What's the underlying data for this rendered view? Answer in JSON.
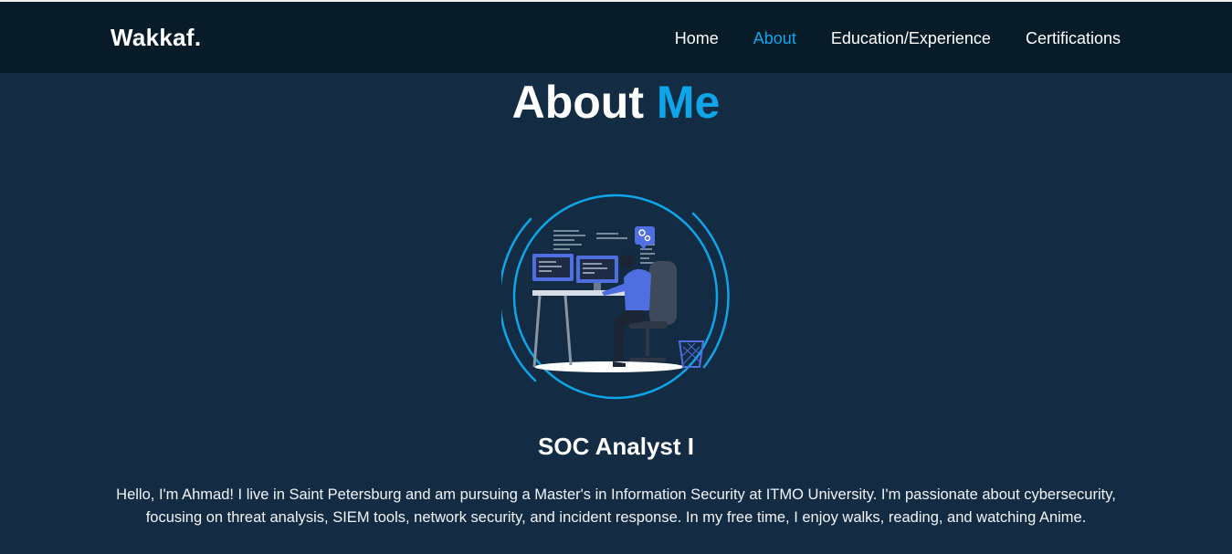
{
  "header": {
    "logo": "Wakkaf.",
    "nav": [
      {
        "label": "Home",
        "active": false
      },
      {
        "label": "About",
        "active": true
      },
      {
        "label": "Education/Experience",
        "active": false
      },
      {
        "label": "Certifications",
        "active": false
      }
    ]
  },
  "about": {
    "title_main": "About",
    "title_accent": "Me",
    "image_subject": "person working at computer desk illustration",
    "role": "SOC Analyst I",
    "bio": "Hello, I'm Ahmad! I live in Saint Petersburg and am pursuing a Master's in Information Security at ITMO University. I'm passionate about cybersecurity, focusing on threat analysis, SIEM tools, network security, and incident response. In my free time, I enjoy walks, reading, and watching Anime."
  },
  "colors": {
    "background": "#132c43",
    "header_background": "#081b29",
    "accent": "#0ea5e9",
    "text": "#ffffff"
  }
}
